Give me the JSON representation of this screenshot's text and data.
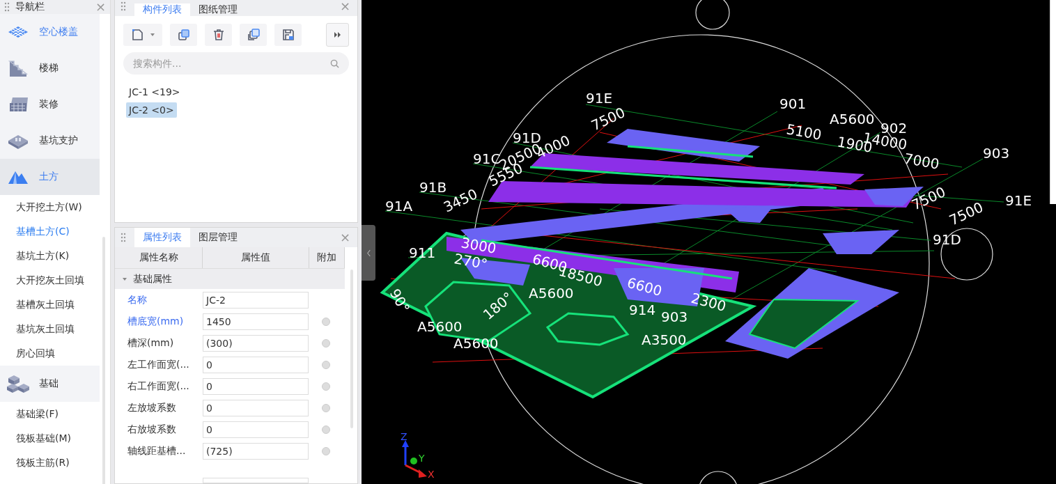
{
  "navigation": {
    "title": "导航栏",
    "close": "×",
    "groups": [
      {
        "label": "空心楼盖",
        "highlighted": true,
        "selected": false
      },
      {
        "label": "楼梯",
        "highlighted": false,
        "selected": false
      },
      {
        "label": "装修",
        "highlighted": false,
        "selected": false
      },
      {
        "label": "基坑支护",
        "highlighted": false,
        "selected": false
      },
      {
        "label": "土方",
        "highlighted": true,
        "selected": true,
        "children": [
          {
            "label": "大开挖土方(W)",
            "selected": false
          },
          {
            "label": "基槽土方(C)",
            "selected": true
          },
          {
            "label": "基坑土方(K)",
            "selected": false
          },
          {
            "label": "大开挖灰土回填",
            "selected": false
          },
          {
            "label": "基槽灰土回填",
            "selected": false
          },
          {
            "label": "基坑灰土回填",
            "selected": false
          },
          {
            "label": "房心回填",
            "selected": false
          }
        ]
      },
      {
        "label": "基础",
        "highlighted": false,
        "selected": false,
        "children": [
          {
            "label": "基础梁(F)",
            "selected": false
          },
          {
            "label": "筏板基础(M)",
            "selected": false
          },
          {
            "label": "筏板主筋(R)",
            "selected": false
          }
        ]
      }
    ]
  },
  "component_panel": {
    "tabs": [
      {
        "label": "构件列表",
        "selected": true
      },
      {
        "label": "图纸管理",
        "selected": false
      }
    ],
    "close": "×",
    "search": {
      "placeholder": "搜索构件..."
    },
    "items": [
      {
        "label": "JC-1 <19>",
        "selected": false
      },
      {
        "label": "JC-2 <0>",
        "selected": true
      }
    ]
  },
  "property_panel": {
    "tabs": [
      {
        "label": "属性列表",
        "selected": true
      },
      {
        "label": "图层管理",
        "selected": false
      }
    ],
    "close": "×",
    "columns": [
      "属性名称",
      "属性值",
      "附加"
    ],
    "group": {
      "label": "基础属性",
      "expanded": true
    },
    "rows": [
      {
        "name": "名称",
        "value": "JC-2",
        "highlighted": true,
        "attachable": false
      },
      {
        "name": "槽底宽(mm)",
        "value": "1450",
        "highlighted": true,
        "attachable": true
      },
      {
        "name": "槽深(mm)",
        "value": "(300)",
        "highlighted": false,
        "attachable": true
      },
      {
        "name": "左工作面宽(...",
        "value": "0",
        "highlighted": false,
        "attachable": true
      },
      {
        "name": "右工作面宽(...",
        "value": "0",
        "highlighted": false,
        "attachable": true
      },
      {
        "name": "左放坡系数",
        "value": "0",
        "highlighted": false,
        "attachable": true
      },
      {
        "name": "右放坡系数",
        "value": "0",
        "highlighted": false,
        "attachable": true
      },
      {
        "name": "轴线距基槽...",
        "value": "(725)",
        "highlighted": false,
        "attachable": true
      }
    ]
  },
  "viewport": {
    "axis_labels": [
      "91E",
      "901",
      "91D",
      "91C",
      "91B",
      "91A",
      "911",
      "902",
      "903",
      "91E",
      "91D"
    ],
    "dimension_labels": [
      "7500",
      "20500",
      "4000",
      "5550",
      "3450",
      "5100",
      "A5600",
      "14000",
      "1900",
      "7000",
      "7500",
      "7500",
      "3000",
      "270°",
      "6600",
      "18500",
      "A5600",
      "6600",
      "2300",
      "90°",
      "180°",
      "914",
      "903",
      "A5600",
      "A5600",
      "A3500"
    ],
    "gizmo": [
      "Z",
      "Y",
      "X"
    ]
  }
}
